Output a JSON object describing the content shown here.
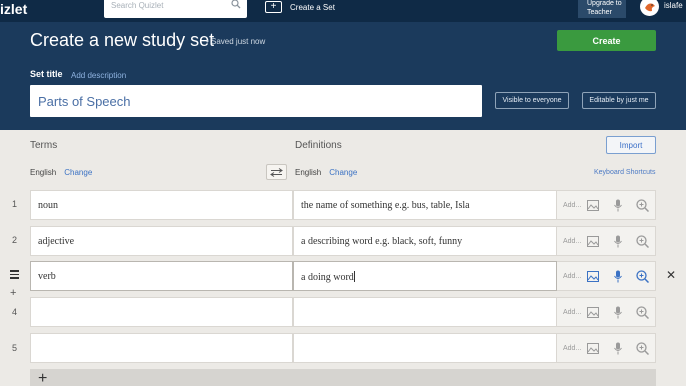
{
  "nav": {
    "logo": "izlet",
    "search_placeholder": "Search Quizlet",
    "create_set": "Create a Set",
    "upgrade_line1": "Upgrade to",
    "upgrade_line2": "Teacher",
    "username": "islafe"
  },
  "header": {
    "title": "Create a new study set",
    "saved": "• Saved just now",
    "create_button": "Create",
    "set_title_label": "Set title",
    "add_description": "Add description",
    "title_value": "Parts of Speech",
    "visible_button": "Visible to everyone",
    "editable_button": "Editable by just me"
  },
  "columns": {
    "terms": "Terms",
    "definitions": "Definitions",
    "import": "Import",
    "terms_lang": "English",
    "defs_lang": "English",
    "change": "Change",
    "keyboard_shortcuts": "Keyboard Shortcuts"
  },
  "cards": [
    {
      "num": "1",
      "term": "noun",
      "definition": "the name of something e.g. bus, table, Isla"
    },
    {
      "num": "2",
      "term": "adjective",
      "definition": "a describing word e.g. black, soft, funny"
    },
    {
      "num": "",
      "term": "verb",
      "definition": "a doing word"
    },
    {
      "num": "4",
      "term": "",
      "definition": ""
    },
    {
      "num": "5",
      "term": "",
      "definition": ""
    }
  ],
  "card_tools": {
    "add": "Add..."
  },
  "colors": {
    "nav_bg": "#0f2a46",
    "header_bg": "#1b3a5c",
    "create_green": "#3a9a3f",
    "link_blue": "#3b72c4"
  },
  "icons": [
    "search-icon",
    "plus-icon",
    "image-icon",
    "mic-icon",
    "zoom-icon",
    "swap-icon",
    "drag-handle-icon",
    "close-icon"
  ]
}
